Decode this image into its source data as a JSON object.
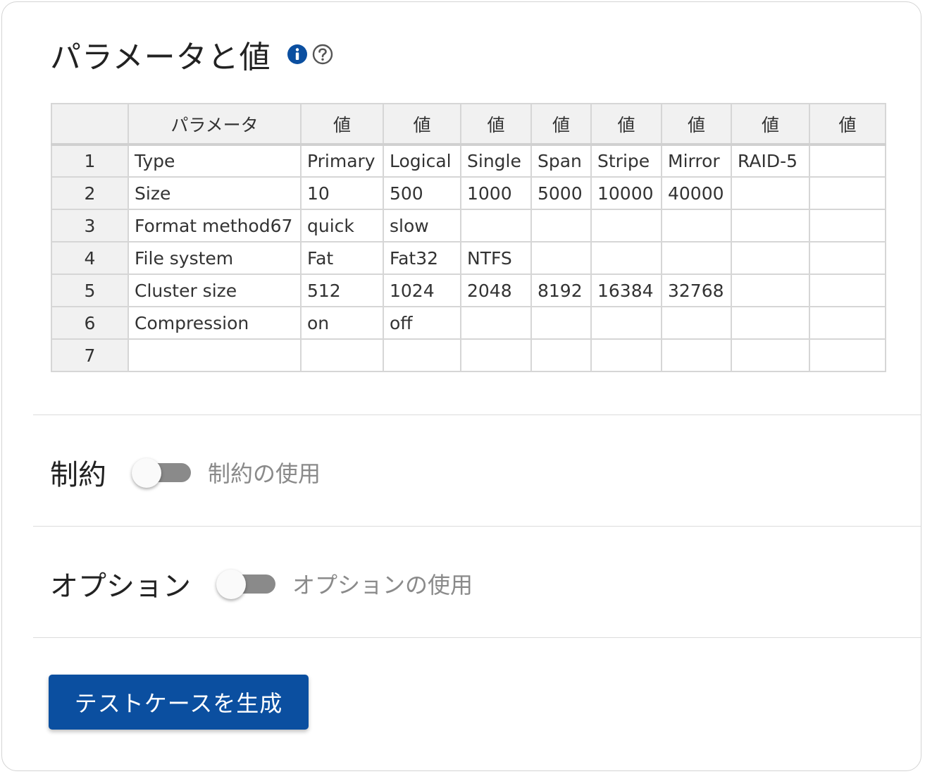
{
  "section_title": "パラメータと値",
  "icons": {
    "info": "info-icon",
    "help": "help-icon"
  },
  "colors": {
    "accent": "#0b4fa0",
    "toggle_off_track": "#8a8a8a"
  },
  "table": {
    "headers": [
      "",
      "パラメータ",
      "値",
      "値",
      "値",
      "値",
      "値",
      "値",
      "値",
      "値"
    ],
    "rows": [
      [
        "1",
        "Type",
        "Primary",
        "Logical",
        "Single",
        "Span",
        "Stripe",
        "Mirror",
        "RAID-5",
        ""
      ],
      [
        "2",
        "Size",
        "10",
        "500",
        "1000",
        "5000",
        "10000",
        "40000",
        "",
        ""
      ],
      [
        "3",
        "Format method67",
        "quick",
        "slow",
        "",
        "",
        "",
        "",
        "",
        ""
      ],
      [
        "4",
        "File system",
        "Fat",
        "Fat32",
        "NTFS",
        "",
        "",
        "",
        "",
        ""
      ],
      [
        "5",
        "Cluster size",
        "512",
        "1024",
        "2048",
        "8192",
        "16384",
        "32768",
        "",
        ""
      ],
      [
        "6",
        "Compression",
        "on",
        "off",
        "",
        "",
        "",
        "",
        "",
        ""
      ],
      [
        "7",
        "",
        "",
        "",
        "",
        "",
        "",
        "",
        "",
        ""
      ]
    ]
  },
  "constraints": {
    "label": "制約",
    "toggle_text": "制約の使用",
    "enabled": false
  },
  "options": {
    "label": "オプション",
    "toggle_text": "オプションの使用",
    "enabled": false
  },
  "generate_button": {
    "label": "テストケースを生成"
  }
}
